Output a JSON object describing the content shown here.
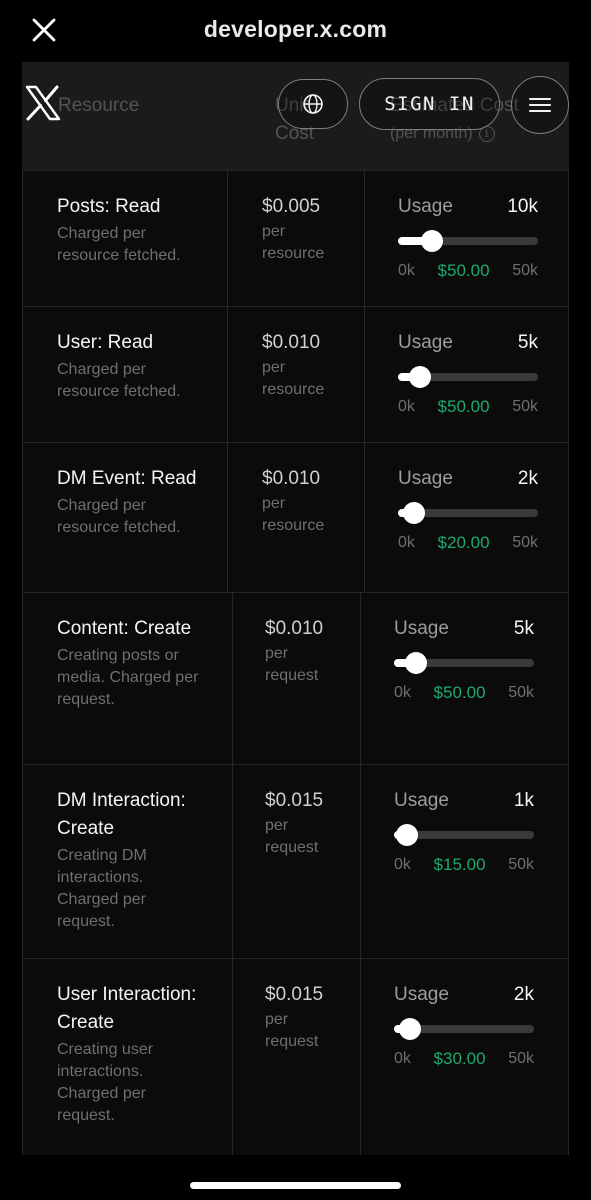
{
  "browser": {
    "url": "developer.x.com"
  },
  "header": {
    "sign_in_label": "SIGN IN"
  },
  "table": {
    "columns": {
      "resource": "Resource",
      "unit_cost_line1": "Unit",
      "unit_cost_line2": "Cost",
      "estimated_cost": "Estimated Cost",
      "estimated_sub": "(per month)"
    },
    "rows": [
      {
        "name": "Posts: Read",
        "description": "Charged per resource fetched.",
        "price": "$0.005",
        "per": "per resource",
        "usage_label": "Usage",
        "usage": "10k",
        "usage_fraction": 0.2,
        "min": "0k",
        "max": "50k",
        "cost": "$50.00"
      },
      {
        "name": "User: Read",
        "description": "Charged per resource fetched.",
        "price": "$0.010",
        "per": "per resource",
        "usage_label": "Usage",
        "usage": "5k",
        "usage_fraction": 0.1,
        "min": "0k",
        "max": "50k",
        "cost": "$50.00"
      },
      {
        "name": "DM Event: Read",
        "description": "Charged per resource fetched.",
        "price": "$0.010",
        "per": "per resource",
        "usage_label": "Usage",
        "usage": "2k",
        "usage_fraction": 0.04,
        "min": "0k",
        "max": "50k",
        "cost": "$20.00"
      },
      {
        "name": "Content: Create",
        "description": "Creating posts or media. Charged per request.",
        "price": "$0.010",
        "per": "per request",
        "usage_label": "Usage",
        "usage": "5k",
        "usage_fraction": 0.1,
        "min": "0k",
        "max": "50k",
        "cost": "$50.00"
      },
      {
        "name": "DM Interaction: Create",
        "description": "Creating DM interactions. Charged per request.",
        "price": "$0.015",
        "per": "per request",
        "usage_label": "Usage",
        "usage": "1k",
        "usage_fraction": 0.02,
        "min": "0k",
        "max": "50k",
        "cost": "$15.00"
      },
      {
        "name": "User Interaction: Create",
        "description": "Creating user interactions. Charged per request.",
        "price": "$0.015",
        "per": "per request",
        "usage_label": "Usage",
        "usage": "2k",
        "usage_fraction": 0.04,
        "min": "0k",
        "max": "50k",
        "cost": "$30.00"
      }
    ]
  },
  "colors": {
    "cost_green": "#1fa96b",
    "background": "#000000",
    "header_bg": "#1b1b1b"
  },
  "icons": {
    "close": "close-icon",
    "logo": "x-logo-icon",
    "globe": "globe-icon",
    "menu": "hamburger-icon",
    "info": "info-icon"
  }
}
